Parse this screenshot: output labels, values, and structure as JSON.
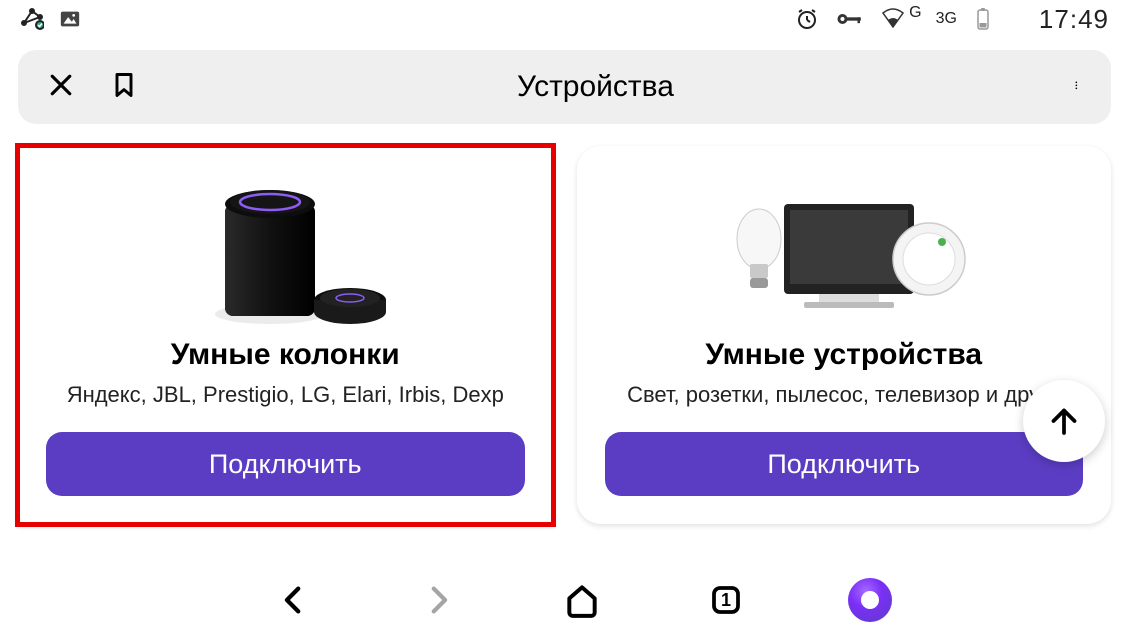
{
  "status": {
    "time": "17:49",
    "labelG": "G",
    "label3G": "3G"
  },
  "header": {
    "title": "Устройства"
  },
  "cards": [
    {
      "title": "Умные колонки",
      "subtitle": "Яндекс, JBL, Prestigio, LG, Elari, Irbis, Dexp",
      "button": "Подключить"
    },
    {
      "title": "Умные устройства",
      "subtitle": "Свет, розетки, пылесос, телевизор и други",
      "button": "Подключить"
    }
  ],
  "nav": {
    "tabs_count": "1"
  }
}
